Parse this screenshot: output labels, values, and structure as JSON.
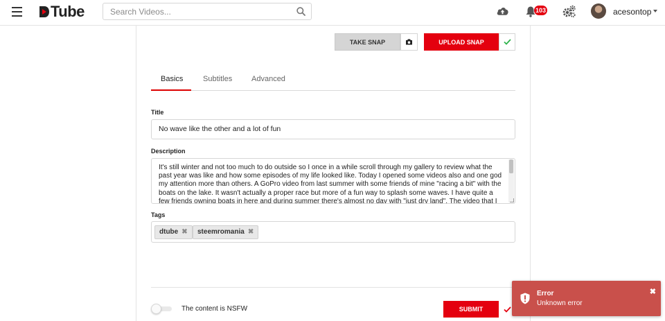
{
  "app": {
    "logo_text": "Tube",
    "brand_color": "#e4000f"
  },
  "header": {
    "search_placeholder": "Search Videos...",
    "notification_count": "103",
    "username": "acesontop",
    "icons": [
      "menu-icon",
      "search-icon",
      "upload-icon",
      "bell-icon",
      "gears-icon",
      "caret-down-icon"
    ]
  },
  "snap": {
    "take_label": "TAKE SNAP",
    "upload_label": "UPLOAD SNAP"
  },
  "tabs": [
    {
      "label": "Basics",
      "active": true
    },
    {
      "label": "Subtitles",
      "active": false
    },
    {
      "label": "Advanced",
      "active": false
    }
  ],
  "form": {
    "title_label": "Title",
    "title_value": "No wave like the other and a lot of fun",
    "description_label": "Description",
    "description_value": "It's still winter and not too much to do outside so I once in a while scroll through my gallery to review what the past year was like and how some episodes of my life looked like. Today I opened some videos also and one god my attention more than others. A GoPro video from last summer with some friends of mine \"racing a bit\" with the boats on the lake. It wasn't actually a proper race but more of a fun way to splash some waves. I have quite a few friends owning boats in here and during summer there's almost no day with \"just dry land\". The video that I",
    "tags_label": "Tags",
    "tags": [
      "dtube",
      "steemromania"
    ],
    "tag_remove_glyph": "✖",
    "nsfw_label": "The content is NSFW",
    "nsfw_enabled": false,
    "submit_label": "SUBMIT"
  },
  "toast": {
    "title": "Error",
    "message": "Unknown error",
    "close_glyph": "✖",
    "color": "#c9504b"
  }
}
